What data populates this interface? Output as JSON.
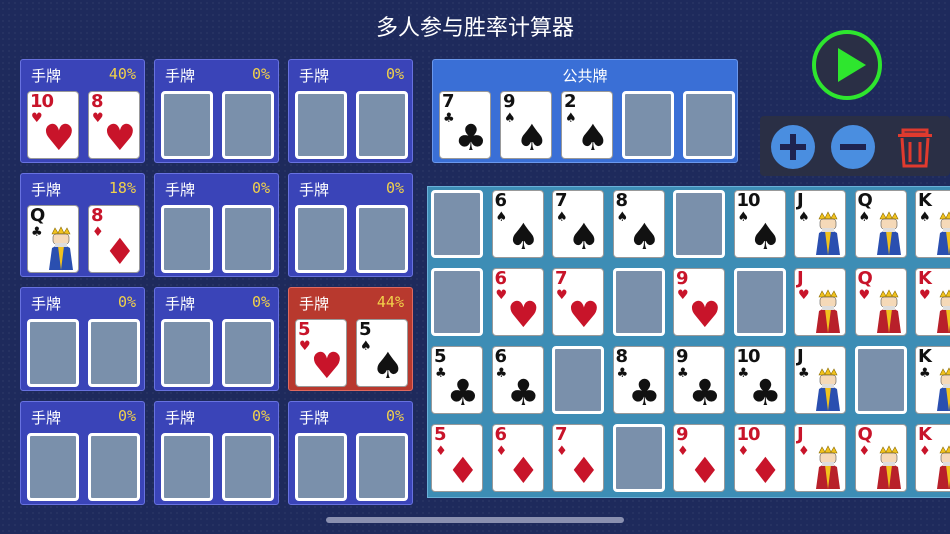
{
  "title": "多人参与胜率计算器",
  "hand_label": "手牌",
  "community_label": "公共牌",
  "hands": [
    {
      "pct": "40%",
      "cards": [
        {
          "rank": "10",
          "suit": "hearts"
        },
        {
          "rank": "8",
          "suit": "hearts"
        }
      ]
    },
    {
      "pct": "0%",
      "cards": [
        null,
        null
      ]
    },
    {
      "pct": "0%",
      "cards": [
        null,
        null
      ]
    },
    {
      "pct": "18%",
      "cards": [
        {
          "rank": "Q",
          "suit": "clubs"
        },
        {
          "rank": "8",
          "suit": "diamonds"
        }
      ]
    },
    {
      "pct": "0%",
      "cards": [
        null,
        null
      ]
    },
    {
      "pct": "0%",
      "cards": [
        null,
        null
      ]
    },
    {
      "pct": "0%",
      "cards": [
        null,
        null
      ]
    },
    {
      "pct": "0%",
      "cards": [
        null,
        null
      ]
    },
    {
      "pct": "44%",
      "highlight": true,
      "cards": [
        {
          "rank": "5",
          "suit": "hearts"
        },
        {
          "rank": "5",
          "suit": "spades"
        }
      ]
    },
    {
      "pct": "0%",
      "cards": [
        null,
        null
      ]
    },
    {
      "pct": "0%",
      "cards": [
        null,
        null
      ]
    },
    {
      "pct": "0%",
      "cards": [
        null,
        null
      ]
    }
  ],
  "community_cards": [
    {
      "rank": "7",
      "suit": "clubs"
    },
    {
      "rank": "9",
      "suit": "spades"
    },
    {
      "rank": "2",
      "suit": "spades"
    },
    null,
    null
  ],
  "deck_rows": [
    {
      "suit": "spades",
      "cards": [
        null,
        "6",
        "7",
        "8",
        null,
        "10",
        "J",
        "Q",
        "K"
      ]
    },
    {
      "suit": "hearts",
      "cards": [
        null,
        "6",
        "7",
        null,
        "9",
        null,
        "J",
        "Q",
        "K"
      ]
    },
    {
      "suit": "clubs",
      "cards": [
        "5",
        "6",
        null,
        "8",
        "9",
        "10",
        "J",
        null,
        "K"
      ]
    },
    {
      "suit": "diamonds",
      "cards": [
        "5",
        "6",
        "7",
        null,
        "9",
        "10",
        "J",
        "Q",
        "K"
      ]
    }
  ],
  "controls": {
    "play": "play-icon",
    "add": "plus-icon",
    "remove": "minus-icon",
    "delete": "trash-icon"
  },
  "colors": {
    "accent_green": "#2ee62e",
    "control_blue": "#4a8ee0",
    "trash_red": "#e03a2e",
    "percent_yellow": "#f1d14a"
  }
}
